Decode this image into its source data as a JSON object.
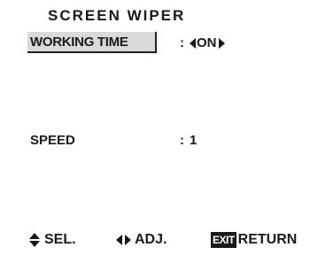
{
  "menu": {
    "title": "SCREEN WIPER",
    "items": [
      {
        "label": "WORKING TIME",
        "colon": ":",
        "value": "ON",
        "selected": true
      },
      {
        "label": "SPEED",
        "colon": ":",
        "value": "1",
        "selected": false
      }
    ]
  },
  "footer": {
    "select_label": "SEL.",
    "adjust_label": "ADJ.",
    "exit_key": "EXIT",
    "return_label": "RETURN",
    "select_icon": "up-down-arrows-icon",
    "adjust_icon": "left-right-arrows-icon"
  }
}
